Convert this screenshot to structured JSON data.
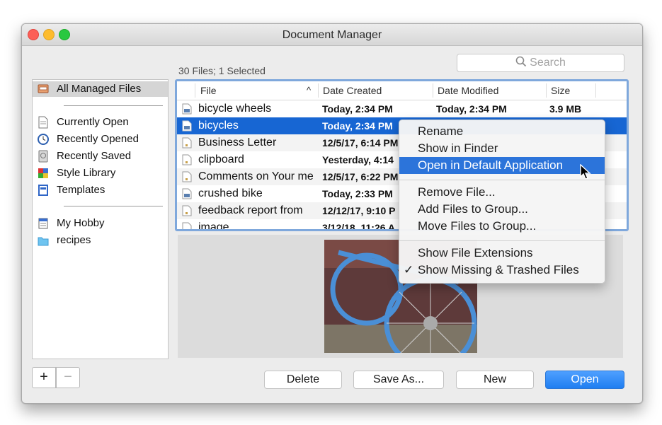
{
  "window": {
    "title": "Document Manager"
  },
  "search": {
    "placeholder": "Search"
  },
  "file_count": "30 Files; 1 Selected",
  "sidebar": {
    "groups": [
      [
        {
          "label": "All Managed Files",
          "icon": "archive-icon",
          "selected": true
        }
      ],
      [
        {
          "label": "Currently Open",
          "icon": "document-icon"
        },
        {
          "label": "Recently Opened",
          "icon": "clock-icon"
        },
        {
          "label": "Recently Saved",
          "icon": "drive-icon"
        },
        {
          "label": "Style Library",
          "icon": "palette-icon"
        },
        {
          "label": "Templates",
          "icon": "template-icon"
        }
      ],
      [
        {
          "label": "My Hobby",
          "icon": "stack-icon"
        },
        {
          "label": "recipes",
          "icon": "folder-icon"
        }
      ]
    ],
    "add_label": "+",
    "remove_label": "−"
  },
  "table": {
    "columns": [
      "File",
      "Date Created",
      "Date Modified",
      "Size"
    ],
    "sort_indicator": "^",
    "rows": [
      {
        "file": "bicycle wheels",
        "created": "Today, 2:34 PM",
        "modified": "Today, 2:34 PM",
        "size": "3.9 MB",
        "icon": "image-file-icon"
      },
      {
        "file": "bicycles",
        "created": "Today, 2:34 PM",
        "modified": "",
        "size": "",
        "icon": "image-file-icon",
        "selected": true
      },
      {
        "file": "Business Letter",
        "created": "12/5/17, 6:14 PM",
        "modified": "",
        "size": "",
        "icon": "text-file-icon"
      },
      {
        "file": "clipboard",
        "created": "Yesterday, 4:14",
        "modified": "",
        "size": "",
        "icon": "text-file-icon"
      },
      {
        "file": "Comments on Your me",
        "created": "12/5/17, 6:22 PM",
        "modified": "",
        "size": "",
        "icon": "text-file-icon"
      },
      {
        "file": "crushed bike",
        "created": "Today, 2:33 PM",
        "modified": "",
        "size": "",
        "icon": "image-file-icon"
      },
      {
        "file": "feedback report from",
        "created": "12/12/17, 9:10 P",
        "modified": "",
        "size": "",
        "icon": "text-file-icon"
      },
      {
        "file": "image",
        "created": "3/12/18, 11:26 A",
        "modified": "",
        "size": "",
        "icon": "text-file-icon"
      }
    ]
  },
  "buttons": {
    "delete": "Delete",
    "save_as": "Save As...",
    "new": "New",
    "open": "Open"
  },
  "context_menu": {
    "groups": [
      [
        {
          "label": "Rename"
        },
        {
          "label": "Show in Finder"
        },
        {
          "label": "Open in Default Application",
          "highlighted": true
        }
      ],
      [
        {
          "label": "Remove File..."
        },
        {
          "label": "Add Files to Group..."
        },
        {
          "label": "Move Files to Group..."
        }
      ],
      [
        {
          "label": "Show File Extensions"
        },
        {
          "label": "Show Missing & Trashed Files",
          "checked": true
        }
      ]
    ],
    "check_mark": "✓"
  },
  "colors": {
    "selection": "#1766d3",
    "menu_highlight": "#2c74da",
    "primary_button": "#1f7ef1",
    "table_focus_ring": "#7fa8dc"
  }
}
